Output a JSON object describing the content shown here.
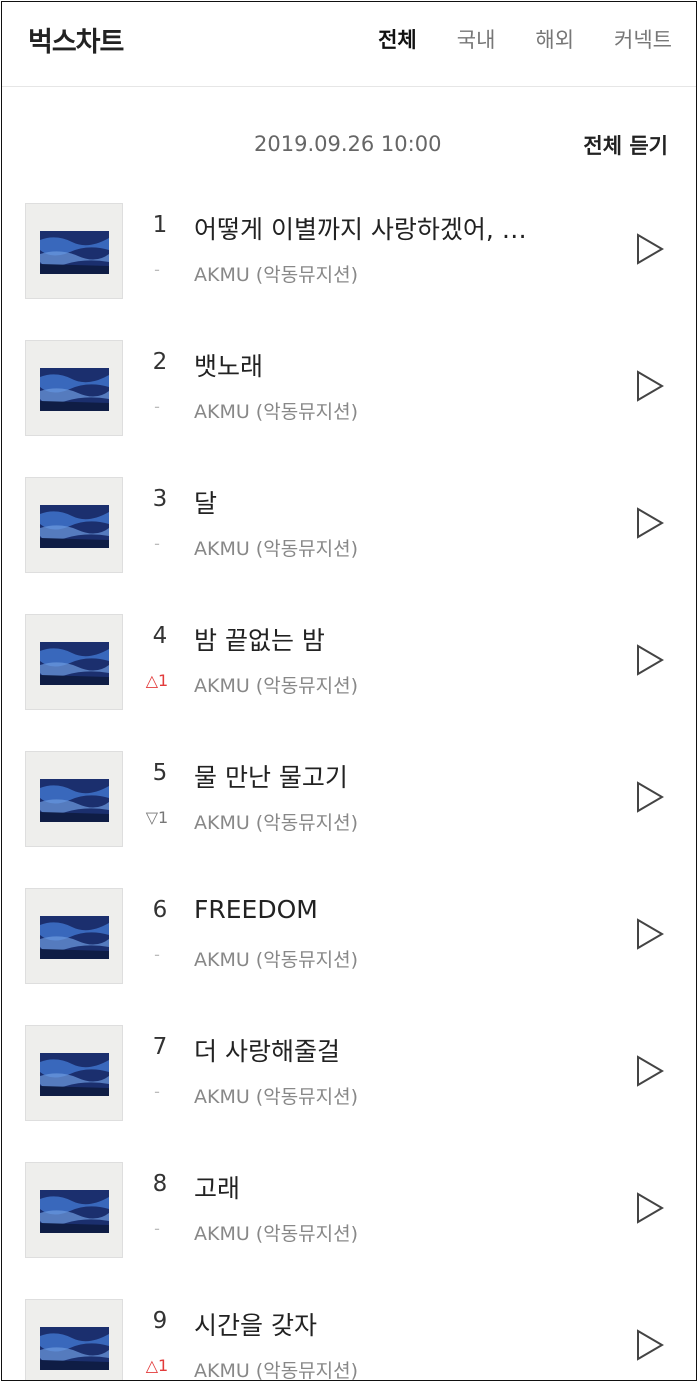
{
  "header": {
    "title": "벅스차트",
    "tabs": [
      {
        "label": "전체",
        "active": true
      },
      {
        "label": "국내",
        "active": false
      },
      {
        "label": "해외",
        "active": false
      },
      {
        "label": "커넥트",
        "active": false
      }
    ]
  },
  "info": {
    "timestamp": "2019.09.26 10:00",
    "play_all_label": "전체 듣기"
  },
  "colors": {
    "rank_up": "#e23b3b",
    "rank_down": "#777777",
    "rank_same": "#bbbbbb"
  },
  "tracks": [
    {
      "rank": "1",
      "title": "어떻게 이별까지 사랑하겠어, …",
      "artist": "AKMU (악동뮤지션)",
      "change": "-",
      "change_dir": "same",
      "icon": "play-icon"
    },
    {
      "rank": "2",
      "title": "뱃노래",
      "artist": "AKMU (악동뮤지션)",
      "change": "-",
      "change_dir": "same",
      "icon": "play-icon"
    },
    {
      "rank": "3",
      "title": "달",
      "artist": "AKMU (악동뮤지션)",
      "change": "-",
      "change_dir": "same",
      "icon": "play-icon"
    },
    {
      "rank": "4",
      "title": "밤 끝없는 밤",
      "artist": "AKMU (악동뮤지션)",
      "change": "△1",
      "change_dir": "up",
      "icon": "play-icon"
    },
    {
      "rank": "5",
      "title": "물 만난 물고기",
      "artist": "AKMU (악동뮤지션)",
      "change": "▽1",
      "change_dir": "down",
      "icon": "play-icon"
    },
    {
      "rank": "6",
      "title": "FREEDOM",
      "artist": "AKMU (악동뮤지션)",
      "change": "-",
      "change_dir": "same",
      "icon": "play-icon"
    },
    {
      "rank": "7",
      "title": "더 사랑해줄걸",
      "artist": "AKMU (악동뮤지션)",
      "change": "-",
      "change_dir": "same",
      "icon": "play-icon"
    },
    {
      "rank": "8",
      "title": "고래",
      "artist": "AKMU (악동뮤지션)",
      "change": "-",
      "change_dir": "same",
      "icon": "play-icon"
    },
    {
      "rank": "9",
      "title": "시간을 갖자",
      "artist": "AKMU (악동뮤지션)",
      "change": "△1",
      "change_dir": "up",
      "icon": "play-icon"
    }
  ]
}
